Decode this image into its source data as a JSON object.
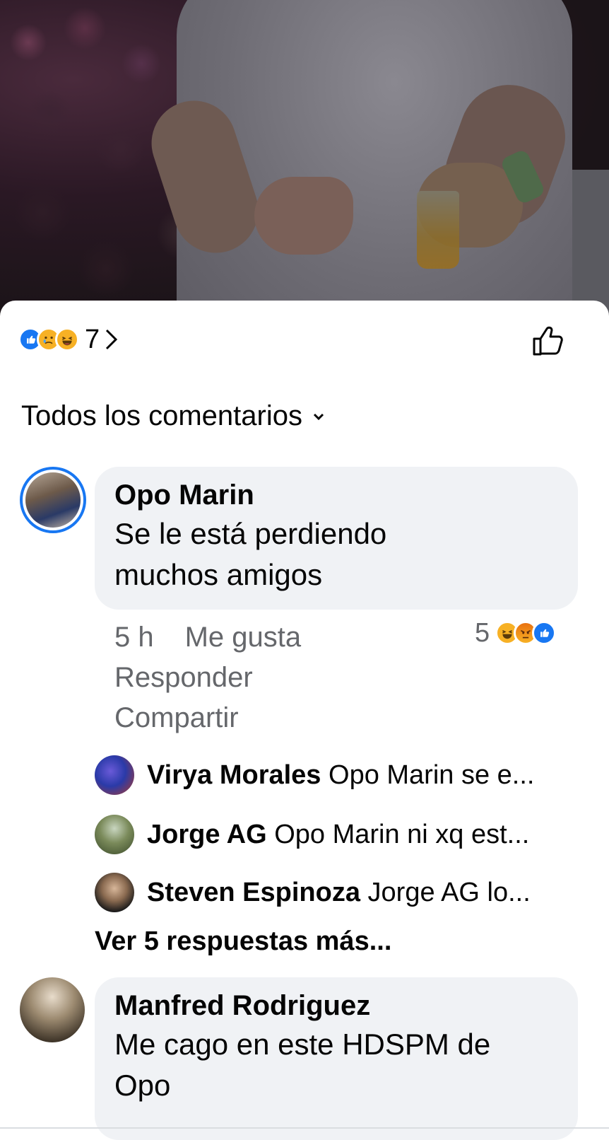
{
  "reactions_summary": {
    "icons": [
      "like-icon",
      "sad-icon",
      "haha-icon"
    ],
    "count": "7"
  },
  "filter": {
    "label": "Todos los comentarios"
  },
  "comments": [
    {
      "author": "Opo Marin",
      "text_line1": "Se le está perdiendo",
      "text_line2": "muchos amigos",
      "time": "5 h",
      "like_label": "Me gusta",
      "reply_label": "Responder",
      "share_label": "Compartir",
      "reaction_count": "5",
      "reaction_icons": [
        "haha-icon",
        "angry-icon",
        "like-icon"
      ],
      "replies": [
        {
          "name": "Virya Morales",
          "text": "Opo Marin se e..."
        },
        {
          "name": "Jorge AG",
          "text": "Opo Marin ni xq est..."
        },
        {
          "name": "Steven Espinoza",
          "text": "Jorge AG lo..."
        }
      ],
      "more_replies": "Ver 5 respuestas más..."
    },
    {
      "author": "Manfred Rodriguez",
      "text_line1": "Me cago en este HDSPM de",
      "text_line2": "Opo"
    }
  ],
  "colors": {
    "facebook_blue": "#1877f2",
    "bubble_bg": "#f0f2f5",
    "secondary_text": "#65676b",
    "emoji_yellow": "#f7b125"
  }
}
